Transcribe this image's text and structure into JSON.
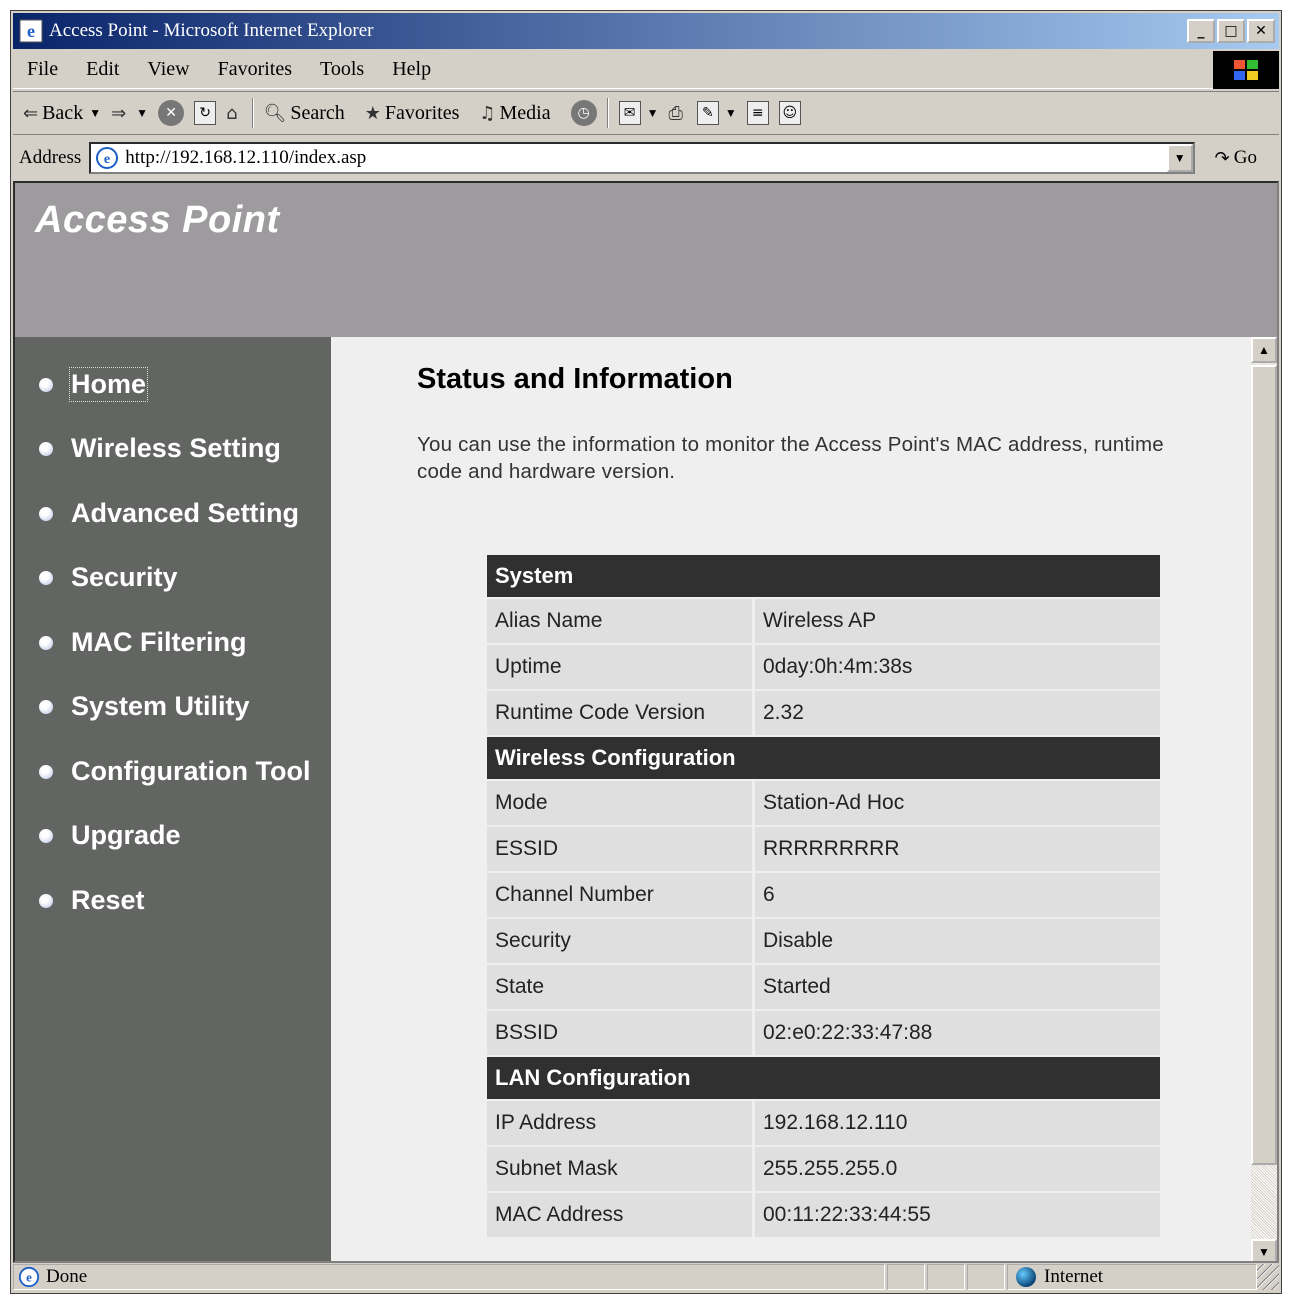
{
  "window": {
    "title": "Access Point - Microsoft Internet Explorer",
    "controls": {
      "minimize": "_",
      "maximize": "□",
      "close": "✕"
    }
  },
  "menu": [
    "File",
    "Edit",
    "View",
    "Favorites",
    "Tools",
    "Help"
  ],
  "toolbar": {
    "back": "Back",
    "search": "Search",
    "favorites": "Favorites",
    "media": "Media"
  },
  "address": {
    "label": "Address",
    "url": "http://192.168.12.110/index.asp",
    "go": "Go"
  },
  "page": {
    "brand": "Access Point",
    "nav": [
      {
        "label": "Home",
        "active": true
      },
      {
        "label": "Wireless Setting"
      },
      {
        "label": "Advanced Setting"
      },
      {
        "label": "Security"
      },
      {
        "label": "MAC Filtering"
      },
      {
        "label": "System Utility"
      },
      {
        "label": "Configuration Tool"
      },
      {
        "label": "Upgrade"
      },
      {
        "label": "Reset"
      }
    ],
    "heading": "Status and Information",
    "description": "You can use the information to monitor the Access Point's MAC address, runtime code and hardware version.",
    "sections": [
      {
        "title": "System",
        "rows": [
          {
            "key": "Alias Name",
            "value": "Wireless AP"
          },
          {
            "key": "Uptime",
            "value": "0day:0h:4m:38s"
          },
          {
            "key": "Runtime Code Version",
            "value": "2.32"
          }
        ]
      },
      {
        "title": "Wireless Configuration",
        "rows": [
          {
            "key": "Mode",
            "value": "Station-Ad Hoc"
          },
          {
            "key": "ESSID",
            "value": "RRRRRRRRR"
          },
          {
            "key": "Channel Number",
            "value": "6"
          },
          {
            "key": "Security",
            "value": "Disable"
          },
          {
            "key": "State",
            "value": "Started"
          },
          {
            "key": "BSSID",
            "value": "02:e0:22:33:47:88"
          }
        ]
      },
      {
        "title": "LAN Configuration",
        "rows": [
          {
            "key": "IP Address",
            "value": "192.168.12.110"
          },
          {
            "key": "Subnet Mask",
            "value": "255.255.255.0"
          },
          {
            "key": "MAC Address",
            "value": "00:11:22:33:44:55"
          }
        ]
      }
    ]
  },
  "status": {
    "text": "Done",
    "zone": "Internet"
  },
  "colors": {
    "banner": "#9e9b9e",
    "sidebar": "#636563",
    "section_header": "#303030",
    "row_bg": "#dfdfdf"
  }
}
